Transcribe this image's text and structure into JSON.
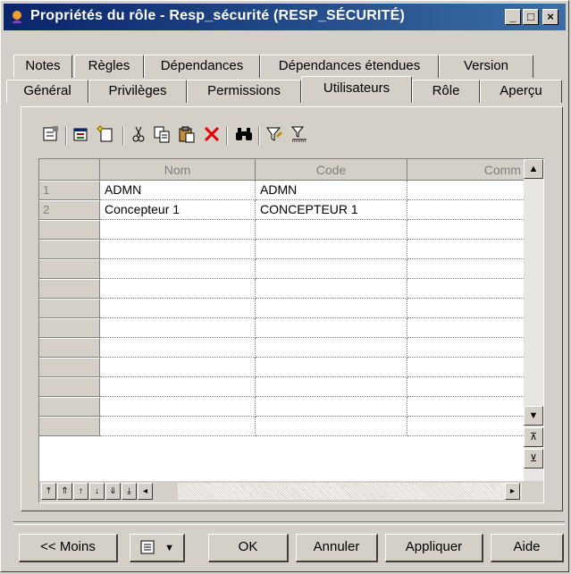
{
  "window": {
    "title": "Propriétés du rôle - Resp_sécurité (RESP_SÉCURITÉ)"
  },
  "titlebar_buttons": {
    "minimize": "_",
    "maximize": "□",
    "close": "×"
  },
  "tabs_row1": [
    "Notes",
    "Règles",
    "Dépendances",
    "Dépendances étendues",
    "Version"
  ],
  "tabs_row2": [
    "Général",
    "Privilèges",
    "Permissions",
    "Utilisateurs",
    "Rôle",
    "Aperçu"
  ],
  "active_tab": "Utilisateurs",
  "toolbar": {
    "icons": [
      "properties-icon",
      "add-objects-icon",
      "create-new-icon",
      "cut-icon",
      "copy-icon",
      "paste-icon",
      "delete-icon",
      "find-icon",
      "filter-icon",
      "customize-columns-icon"
    ]
  },
  "grid": {
    "columns": [
      "Nom",
      "Code",
      "Comm"
    ],
    "rows": [
      {
        "num": "1",
        "nom": "ADMN",
        "code": "ADMN"
      },
      {
        "num": "2",
        "nom": "Concepteur 1",
        "code": "CONCEPTEUR 1"
      }
    ],
    "empty_rows": 11
  },
  "buttons": {
    "less": "<< Moins",
    "ok": "OK",
    "cancel": "Annuler",
    "apply": "Appliquer",
    "help": "Aide"
  }
}
